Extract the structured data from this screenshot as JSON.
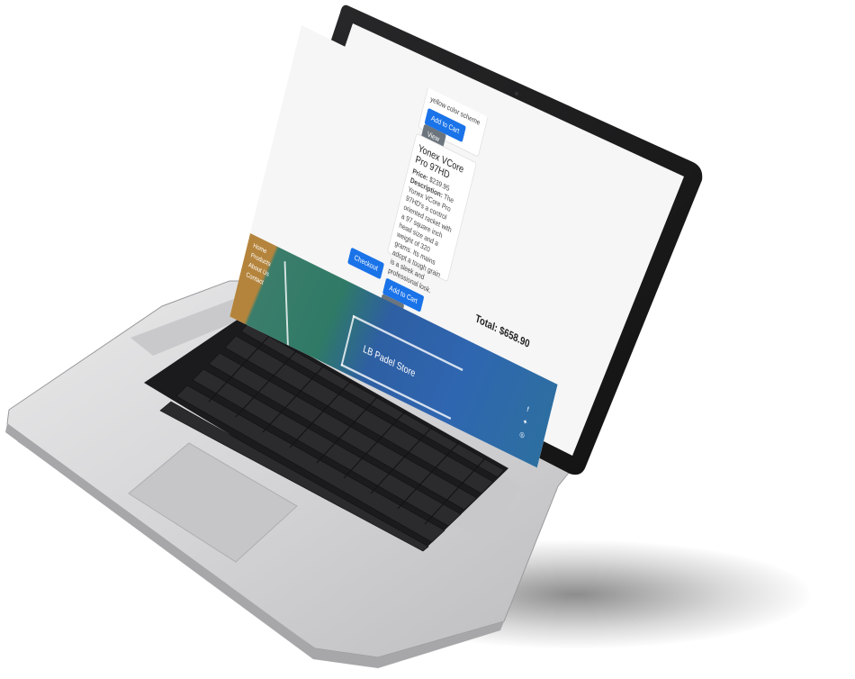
{
  "product_partial": {
    "description_tail": "yellow color scheme",
    "add_to_cart_label": "Add to Cart",
    "view_label": "View"
  },
  "product": {
    "title": "Yonex VCore Pro 97HD",
    "price_label": "Price:",
    "price_value": "$239.95",
    "description_label": "Description:",
    "description_text": "The Yonex VCore Pro 97HD's a control oriented racket with a 97 square inch head size and a weight of 320 grams. Its mains adopt a tough grain is a sleek and professional look.",
    "add_to_cart_label": "Add to Cart",
    "view_label": "View"
  },
  "checkout_label": "Checkout",
  "total_label": "Total: $658.90",
  "footer": {
    "links": [
      "Home",
      "Products",
      "About Us",
      "Contact"
    ],
    "store_name": "LB Padel Store",
    "social_icons": [
      "facebook-icon",
      "twitter-icon",
      "instagram-icon"
    ]
  },
  "colors": {
    "primary_button": "#1a73e8",
    "secondary_button": "#6c757d",
    "page_background": "#f6f6f6"
  }
}
